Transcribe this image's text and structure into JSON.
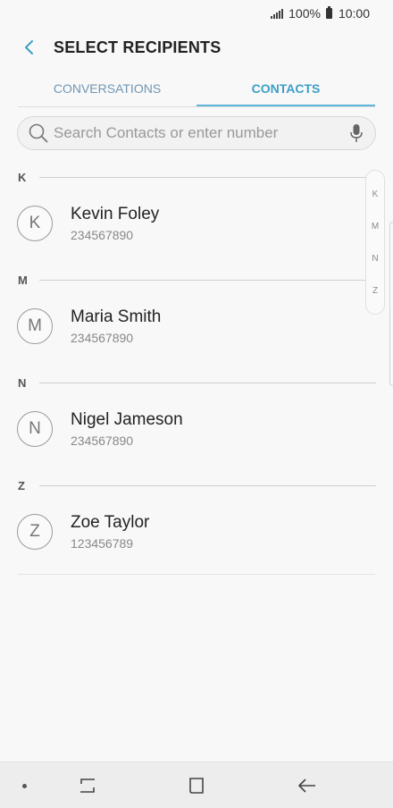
{
  "status_bar": {
    "battery_percent": "100%",
    "time": "10:00"
  },
  "header": {
    "title": "SELECT RECIPIENTS"
  },
  "tabs": [
    {
      "label": "CONVERSATIONS",
      "active": false
    },
    {
      "label": "CONTACTS",
      "active": true
    }
  ],
  "search": {
    "placeholder": "Search Contacts or enter number",
    "value": ""
  },
  "sections": [
    {
      "letter": "K",
      "contacts": [
        {
          "initial": "K",
          "name": "Kevin Foley",
          "number": "234567890"
        }
      ]
    },
    {
      "letter": "M",
      "contacts": [
        {
          "initial": "M",
          "name": "Maria Smith",
          "number": "234567890"
        }
      ]
    },
    {
      "letter": "N",
      "contacts": [
        {
          "initial": "N",
          "name": "Nigel Jameson",
          "number": "234567890"
        }
      ]
    },
    {
      "letter": "Z",
      "contacts": [
        {
          "initial": "Z",
          "name": "Zoe Taylor",
          "number": "123456789"
        }
      ]
    }
  ],
  "index_scroller": [
    "K",
    "M",
    "N",
    "Z"
  ],
  "colors": {
    "accent": "#3d9fc7",
    "tab_inactive": "#6f96b4",
    "background": "#f8f8f8"
  }
}
